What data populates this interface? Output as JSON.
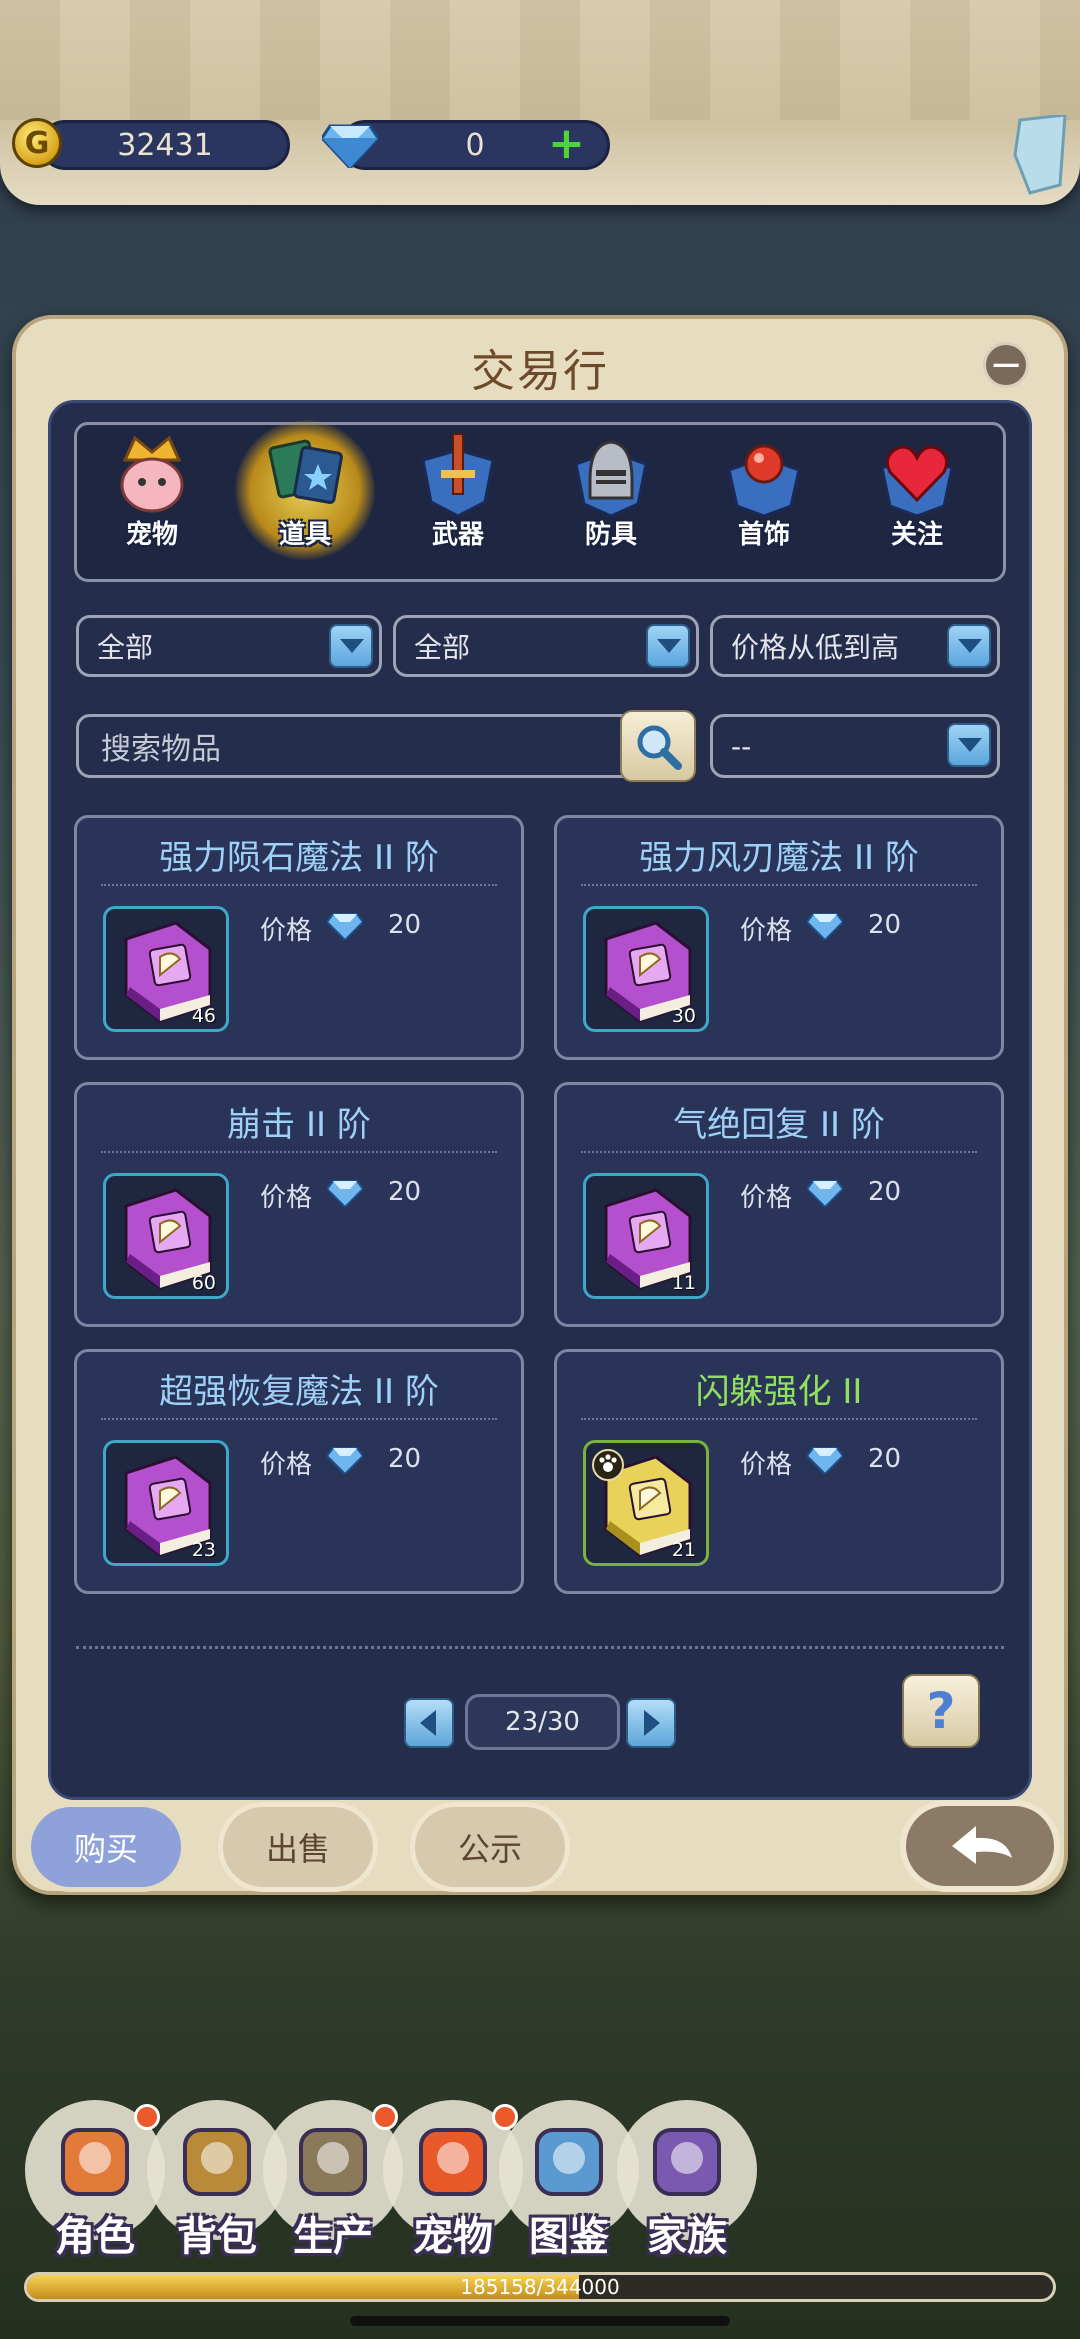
{
  "currency": {
    "gold": "32431",
    "gems": "0",
    "gold_icon_letter": "G"
  },
  "panel": {
    "title": "交易行",
    "minimize_symbol": "−"
  },
  "categories": [
    {
      "label": "宠物",
      "icon": "pet-crown-icon"
    },
    {
      "label": "道具",
      "icon": "item-cards-icon",
      "selected": true
    },
    {
      "label": "武器",
      "icon": "sword-icon"
    },
    {
      "label": "防具",
      "icon": "helmet-icon"
    },
    {
      "label": "首饰",
      "icon": "jewel-icon"
    },
    {
      "label": "关注",
      "icon": "heart-icon"
    }
  ],
  "filters": {
    "filter1": "全部",
    "filter2": "全部",
    "sort": "价格从低到高",
    "search_placeholder": "搜索物品",
    "filter4": "--"
  },
  "items": [
    {
      "name": "强力陨石魔法 II 阶",
      "price_label": "价格",
      "price": "20",
      "qty": "46",
      "book": "purple"
    },
    {
      "name": "强力风刃魔法 II 阶",
      "price_label": "价格",
      "price": "20",
      "qty": "30",
      "book": "purple"
    },
    {
      "name": "崩击 II 阶",
      "price_label": "价格",
      "price": "20",
      "qty": "60",
      "book": "purple"
    },
    {
      "name": "气绝回复 II 阶",
      "price_label": "价格",
      "price": "20",
      "qty": "11",
      "book": "purple"
    },
    {
      "name": "超强恢复魔法 II 阶",
      "price_label": "价格",
      "price": "20",
      "qty": "23",
      "book": "purple"
    },
    {
      "name": "闪躲强化 II",
      "price_label": "价格",
      "price": "20",
      "qty": "21",
      "book": "yellow"
    }
  ],
  "pagination": {
    "page": "23/30"
  },
  "help": {
    "symbol": "?"
  },
  "tabs": [
    {
      "label": "购买",
      "selected": true
    },
    {
      "label": "出售"
    },
    {
      "label": "公示"
    }
  ],
  "nav": [
    {
      "label": "角色",
      "icon": "character-icon",
      "dot": true
    },
    {
      "label": "背包",
      "icon": "backpack-icon",
      "dot": false
    },
    {
      "label": "生产",
      "icon": "pickaxe-icon",
      "dot": true
    },
    {
      "label": "宠物",
      "icon": "pet-icon",
      "dot": true
    },
    {
      "label": "图鉴",
      "icon": "codex-icon",
      "dot": false
    },
    {
      "label": "家族",
      "icon": "family-banner-icon",
      "dot": false
    }
  ],
  "xp": {
    "text": "185158/344000",
    "fraction": 0.538
  },
  "colors": {
    "panel_bg": "#242d4b",
    "frame": "#e6dcc0",
    "accent_blue": "#9fd1f6",
    "accent_green": "#8fe05f"
  }
}
